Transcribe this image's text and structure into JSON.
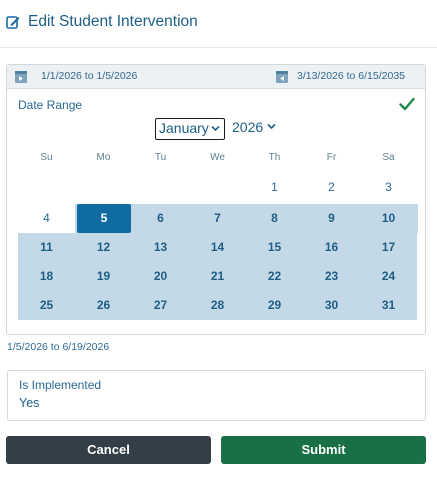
{
  "header": {
    "title": "Edit Student Intervention",
    "icon": "edit-icon"
  },
  "range_bar": {
    "start_text": "1/1/2026 to 1/5/2026",
    "end_text": "3/13/2026 to 6/15/2035"
  },
  "date_range": {
    "label": "Date Range",
    "month": "January",
    "year": "2026",
    "weekdays": [
      "Su",
      "Mo",
      "Tu",
      "We",
      "Th",
      "Fr",
      "Sa"
    ],
    "weeks": [
      [
        "",
        "",
        "",
        "",
        "1",
        "2",
        "3"
      ],
      [
        "4",
        "5",
        "6",
        "7",
        "8",
        "9",
        "10"
      ],
      [
        "11",
        "12",
        "13",
        "14",
        "15",
        "16",
        "17"
      ],
      [
        "18",
        "19",
        "20",
        "21",
        "22",
        "23",
        "24"
      ],
      [
        "25",
        "26",
        "27",
        "28",
        "29",
        "30",
        "31"
      ]
    ],
    "selected_start_day": "5",
    "summary": "1/5/2026 to 6/19/2026"
  },
  "implemented": {
    "label": "Is Implemented",
    "value": "Yes"
  },
  "actions": {
    "cancel": "Cancel",
    "submit": "Submit"
  },
  "colors": {
    "accent": "#0f6ba0",
    "selected_bg": "#c4d9e7",
    "submit": "#187044",
    "cancel": "#343e48"
  }
}
